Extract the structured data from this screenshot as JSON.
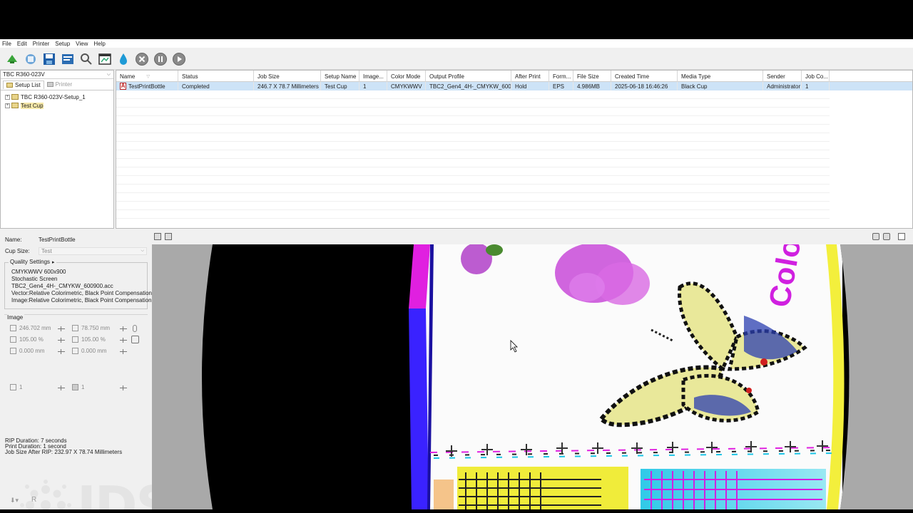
{
  "menu": [
    "File",
    "Edit",
    "Printer",
    "Setup",
    "View",
    "Help"
  ],
  "toolbar_icons": [
    "add-job-icon",
    "rip-icon",
    "save-icon",
    "job-properties-icon",
    "preview-zoom-icon",
    "layout-icon",
    "ink-icon",
    "cancel-icon",
    "pause-icon",
    "play-icon"
  ],
  "left_panel": {
    "printer": "TBC R360-023V",
    "tabs": [
      "Setup List",
      "Printer"
    ],
    "tree": [
      "TBC R360-023V-Setup_1",
      "Test Cup"
    ]
  },
  "job_table": {
    "columns": [
      "Name",
      "Status",
      "Job Size",
      "Setup Name",
      "Image...",
      "Color Mode",
      "Output Profile",
      "After Print",
      "Form...",
      "File Size",
      "Created Time",
      "Media Type",
      "Sender",
      "Job Co..."
    ],
    "rows": [
      [
        "TestPrintBottle",
        "Completed",
        "246.7 X 78.7 Millimeters",
        "Test Cup",
        "1",
        "CMYKWWV",
        "TBC2_Gen4_4H-_CMYKW_600...",
        "Hold",
        "EPS",
        "4.986MB",
        "2025-06-18 16:46:26",
        "Black Cup",
        "Administrator",
        "1"
      ]
    ]
  },
  "props": {
    "name_label": "Name:",
    "name_value": "TestPrintBottle",
    "cup_label": "Cup Size:",
    "cup_value": "Test",
    "quality_label": "Quality Settings",
    "quality_lines": [
      "CMYKWWV    600x900",
      "Stochastic Screen",
      "TBC2_Gen4_4H-_CMYKW_600900.acc",
      "Vector:Relative Colorimetric, Black Point Compensation",
      "Image:Relative Colorimetric, Black Point Compensation"
    ],
    "image_label": "Image",
    "width": "246.702 mm",
    "height": "78.750 mm",
    "scale_x": "105.00 %",
    "scale_y": "105.00 %",
    "offset_x": "0.000 mm",
    "offset_y": "0.000 mm",
    "copies": "1",
    "copies2": "1",
    "rip_duration": "RIP Duration: 7 seconds",
    "print_duration": "Print Duration: 1 second",
    "job_size_after": "Job Size After RIP: 232.97 X 78.74 Millimeters",
    "logo_text": "IDS",
    "bottom_letter": "R"
  },
  "preview": {
    "artwork_text": "Color"
  },
  "colors": {
    "selected_row": "#cde3f7",
    "window_bg": "#f0f0f0",
    "preview_bg": "#a9a9a9"
  }
}
